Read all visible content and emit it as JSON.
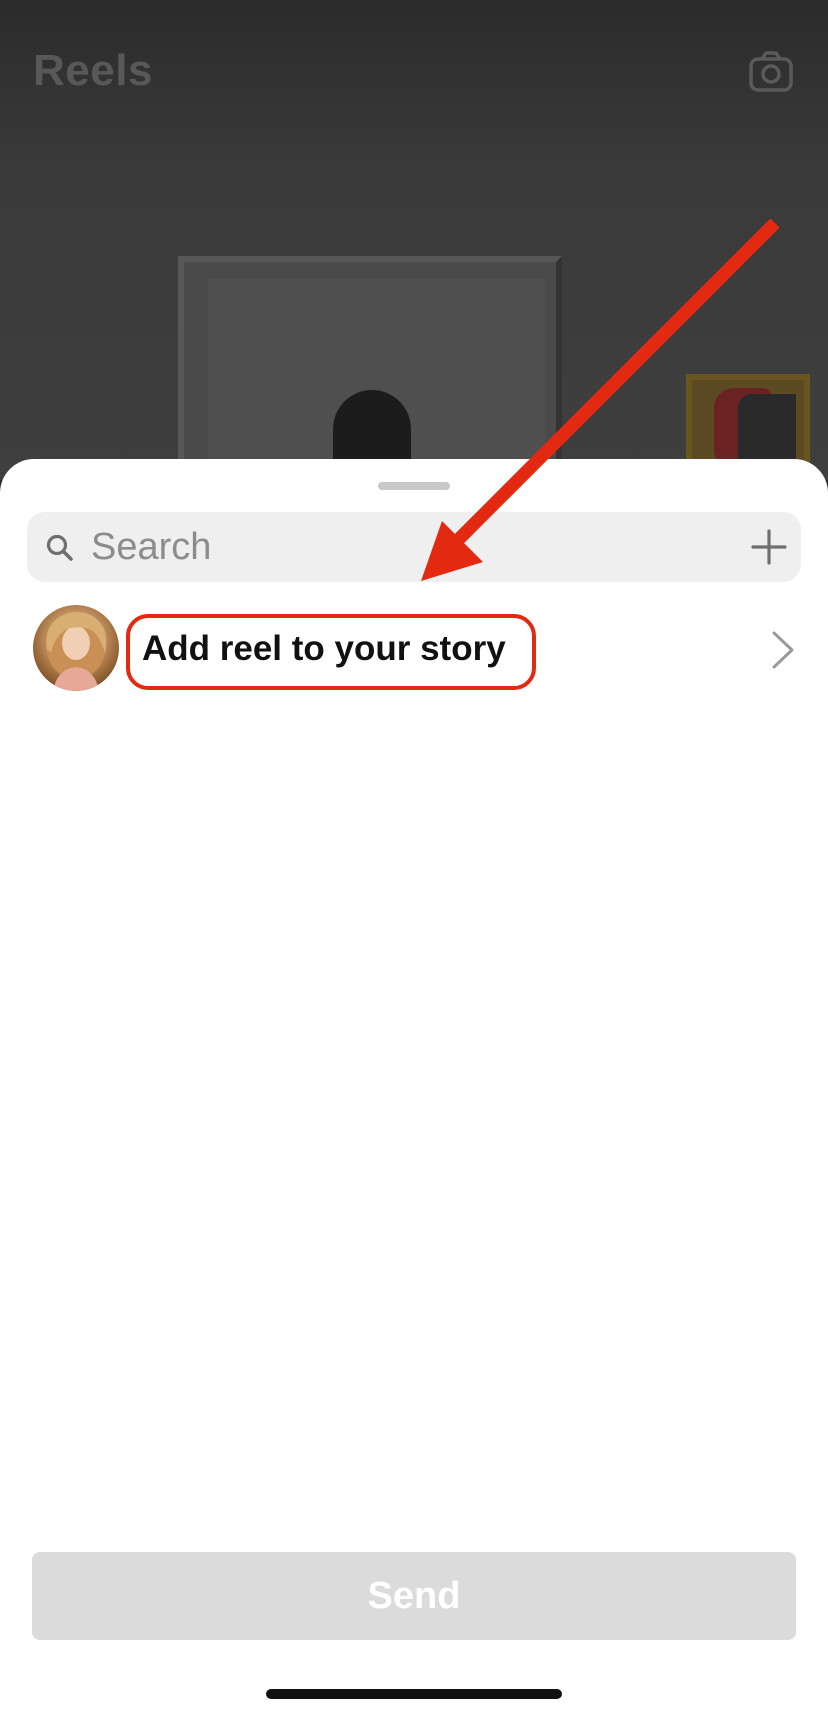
{
  "header": {
    "title": "Reels",
    "camera_icon": "camera-icon"
  },
  "search": {
    "placeholder": "Search",
    "value": "",
    "search_icon": "search-icon",
    "add_icon": "plus-icon"
  },
  "story_row": {
    "label": "Add reel to your story",
    "chevron_icon": "chevron-right-icon"
  },
  "send": {
    "label": "Send"
  },
  "colors": {
    "annotation": "#e3290f",
    "send_disabled_bg": "#dbdbdb",
    "search_bg": "#efefef"
  }
}
